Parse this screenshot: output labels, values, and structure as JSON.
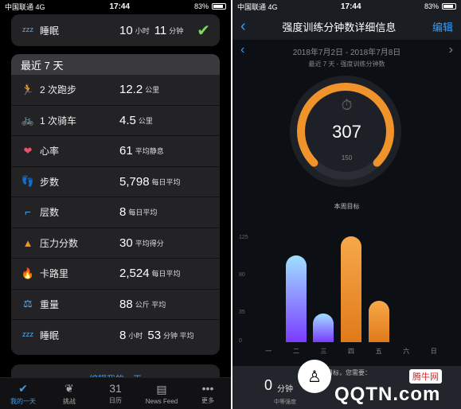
{
  "status": {
    "carrier": "中国联通",
    "network": "4G",
    "time": "17:44",
    "battery": "83%"
  },
  "left": {
    "top_sleep": {
      "label": "睡眠",
      "hours": "10",
      "hours_unit": "小时",
      "minutes": "11",
      "minutes_unit": "分钟"
    },
    "section_title": "最近 7 天",
    "rows": [
      {
        "icon": "running-icon",
        "glyph": "🏃",
        "label": "2 次跑步",
        "value": "12.2",
        "unit": "公里"
      },
      {
        "icon": "bike-icon",
        "glyph": "🚲",
        "label": "1 次骑车",
        "value": "4.5",
        "unit": "公里"
      },
      {
        "icon": "heart-icon",
        "glyph": "❤",
        "label": "心率",
        "value": "61",
        "unit": "平均静息"
      },
      {
        "icon": "steps-icon",
        "glyph": "👣",
        "label": "步数",
        "value": "5,798",
        "unit": "每日平均"
      },
      {
        "icon": "stairs-icon",
        "glyph": "⌐",
        "label": "层数",
        "value": "8",
        "unit": "每日平均"
      },
      {
        "icon": "stress-icon",
        "glyph": "▲",
        "label": "压力分数",
        "value": "30",
        "unit": "平均得分"
      },
      {
        "icon": "flame-icon",
        "glyph": "🔥",
        "label": "卡路里",
        "value": "2,524",
        "unit": "每日平均"
      },
      {
        "icon": "scale-icon",
        "glyph": "⚖",
        "label": "重量",
        "value": "88",
        "unit": "公斤 平均"
      },
      {
        "icon": "sleep-icon",
        "glyph": "ᶻᶻᶻ",
        "label": "睡眠",
        "value": "8",
        "unit": "小时",
        "value2": "53",
        "unit2": "分钟 平均"
      }
    ],
    "bottom_partial": "编辑我的一天",
    "tabs": [
      {
        "label": "我的一天",
        "icon": "check-icon",
        "glyph": "✔",
        "active": true
      },
      {
        "label": "挑战",
        "icon": "laurel-icon",
        "glyph": "❦",
        "active": false
      },
      {
        "label": "日历",
        "icon": "calendar-icon",
        "glyph": "31",
        "active": false
      },
      {
        "label": "News Feed",
        "icon": "news-icon",
        "glyph": "▤",
        "active": false
      },
      {
        "label": "更多",
        "icon": "more-icon",
        "glyph": "•••",
        "active": false
      }
    ]
  },
  "right": {
    "nav_title": "强度训练分钟数详细信息",
    "edit": "编辑",
    "date_range": "2018年7月2日 - 2018年7月8日",
    "subtitle": "最近 7 天 - 强度训练分钟数",
    "gauge_value": "307",
    "gauge_goal": "150",
    "gauge_caption": "本周目标",
    "bottom_text1": "0",
    "bottom_unit": "分钟",
    "bottom_label": "中等强度",
    "bottom_hint": "目标，您需要：",
    "watermark": "腾牛网",
    "watermark_url": "QQTN.com",
    "colors": {
      "accent": "#f0932b",
      "blue": "#3b9cf0"
    }
  },
  "chart_data": {
    "type": "bar",
    "categories": [
      "一",
      "二",
      "三",
      "四",
      "五",
      "六",
      "日"
    ],
    "values": [
      0,
      105,
      35,
      128,
      50,
      0,
      0
    ],
    "yticks": [
      "0",
      "35",
      "80",
      "125"
    ],
    "ylim": [
      0,
      125
    ]
  }
}
